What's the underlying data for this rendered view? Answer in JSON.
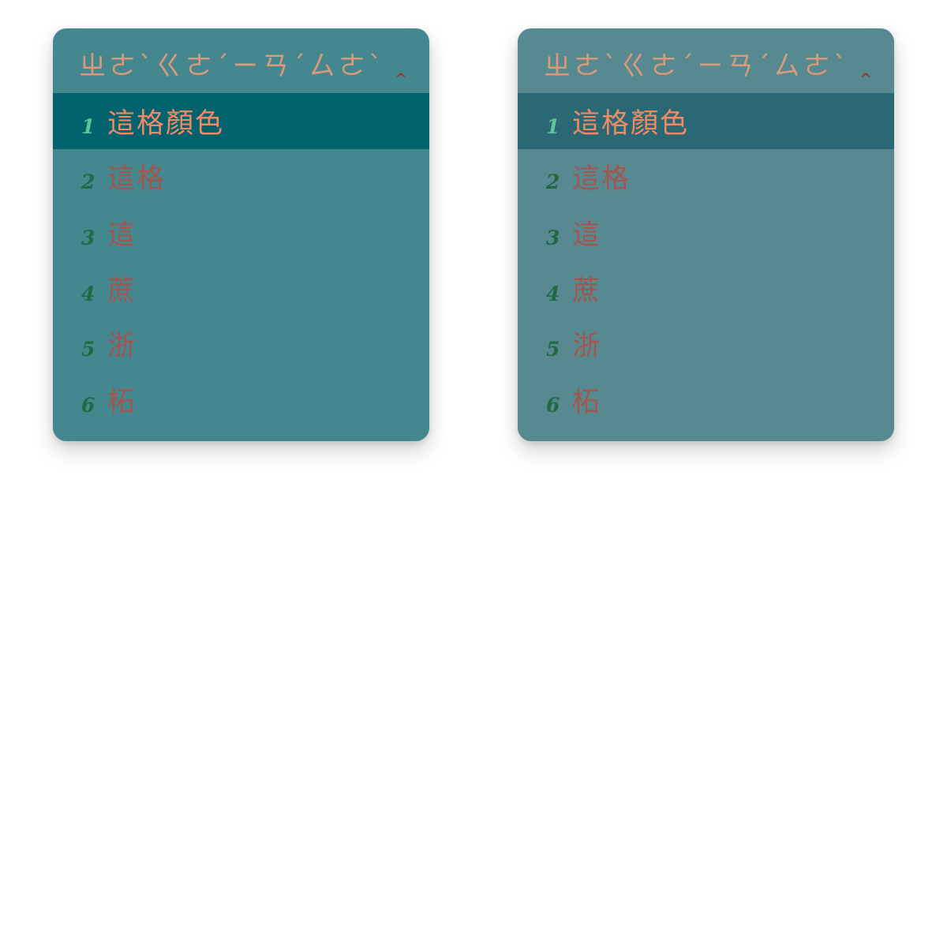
{
  "panels": [
    {
      "id": "panel-a",
      "colors": {
        "background": "#45878f",
        "highlight": "#02636f",
        "preedit_text": "#d89a78",
        "caret": "#9c3a2a",
        "index": "#216845",
        "index_selected": "#5cc79a",
        "candidate_text": "#a2564f",
        "candidate_text_selected": "#f08a62"
      },
      "preedit": {
        "text": "ㄓㄜˋㄍㄜˊㄧㄢˊㄙㄜˋ",
        "caret": "^"
      },
      "selected_index": 0,
      "candidates": [
        {
          "index": "1",
          "text": "這格顏色"
        },
        {
          "index": "2",
          "text": "這格"
        },
        {
          "index": "3",
          "text": "這"
        },
        {
          "index": "4",
          "text": "蔗"
        },
        {
          "index": "5",
          "text": "浙"
        },
        {
          "index": "6",
          "text": "柘"
        }
      ]
    },
    {
      "id": "panel-b",
      "colors": {
        "background": "#568a90",
        "highlight": "#2b6875",
        "preedit_text": "#d89a78",
        "caret": "#9c3a2a",
        "index": "#216845",
        "index_selected": "#5cc79a",
        "candidate_text": "#a2564f",
        "candidate_text_selected": "#f08a62"
      },
      "preedit": {
        "text": "ㄓㄜˋㄍㄜˊㄧㄢˊㄙㄜˋ",
        "caret": "^"
      },
      "selected_index": 0,
      "candidates": [
        {
          "index": "1",
          "text": "這格顏色"
        },
        {
          "index": "2",
          "text": "這格"
        },
        {
          "index": "3",
          "text": "這"
        },
        {
          "index": "4",
          "text": "蔗"
        },
        {
          "index": "5",
          "text": "浙"
        },
        {
          "index": "6",
          "text": "柘"
        }
      ]
    }
  ]
}
